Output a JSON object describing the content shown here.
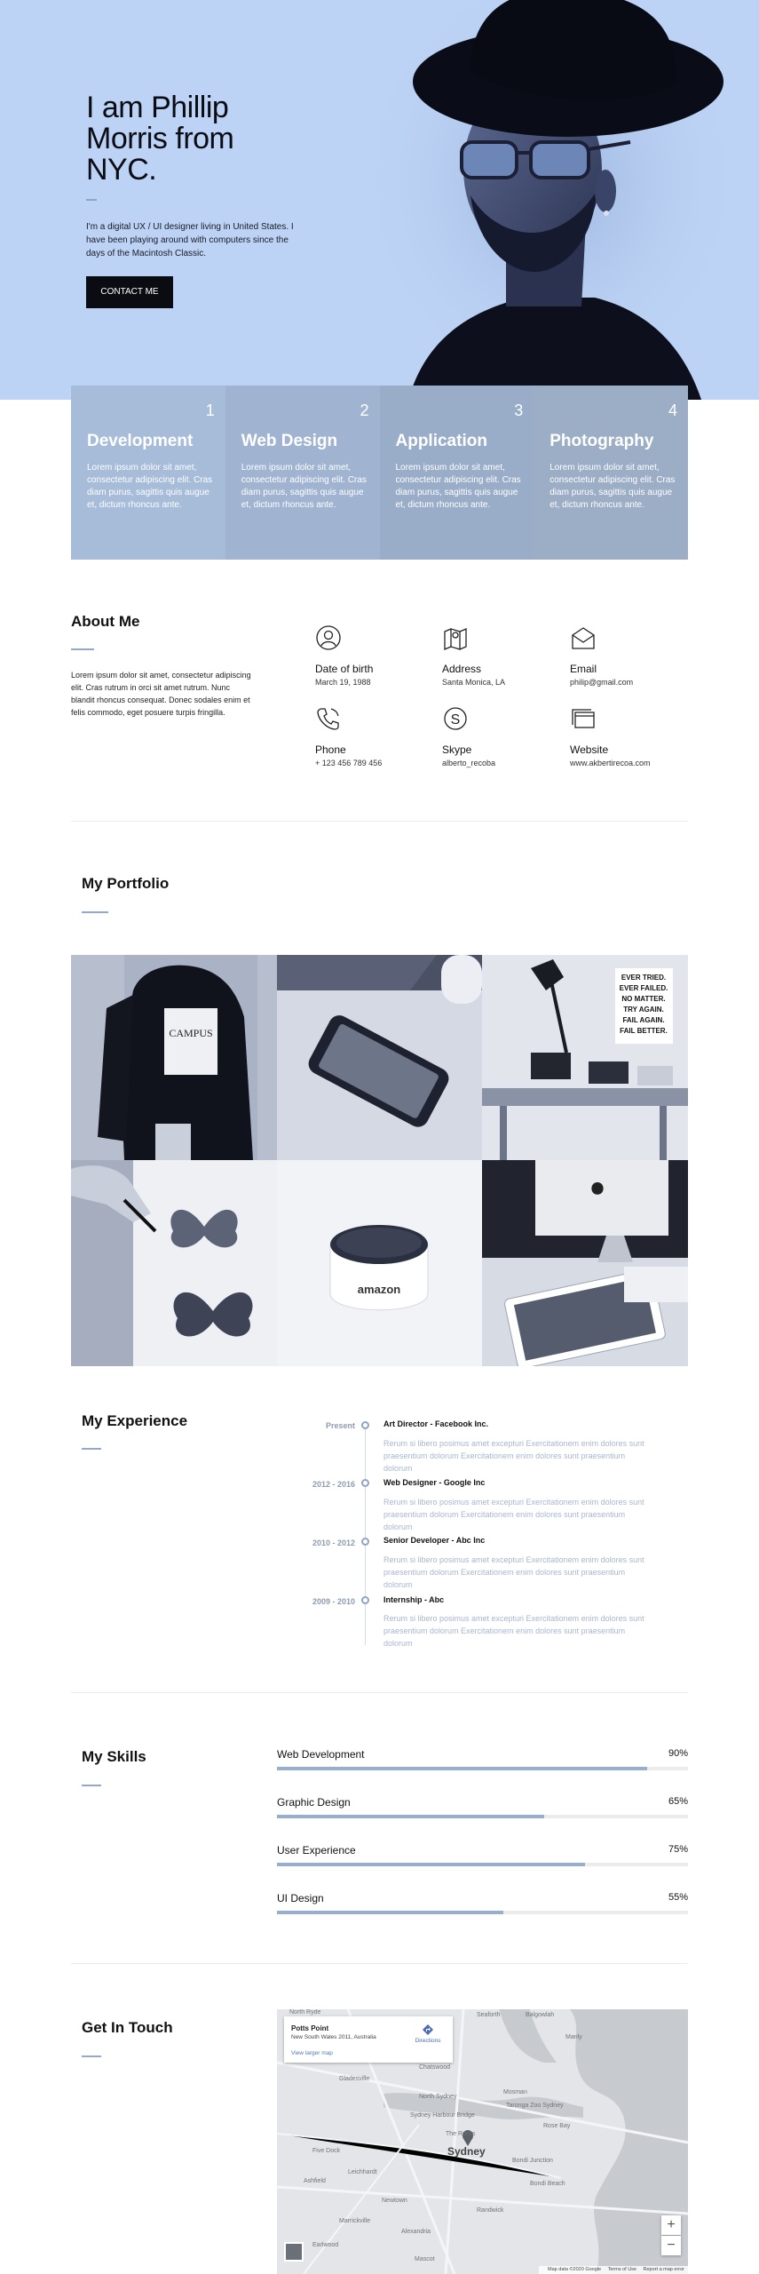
{
  "hero": {
    "title": "I am Phillip Morris from NYC.",
    "intro": "I'm a digital UX / UI designer living in United States. I have been playing around with computers since the days of the Macintosh Classic.",
    "button_label": "CONTACT ME"
  },
  "services": [
    {
      "number": "1",
      "title": "Development",
      "text": "Lorem ipsum dolor sit amet, consectetur adipiscing elit. Cras diam purus, sagittis quis augue et, dictum rhoncus ante."
    },
    {
      "number": "2",
      "title": "Web Design",
      "text": "Lorem ipsum dolor sit amet, consectetur adipiscing elit. Cras diam purus, sagittis quis augue et, dictum rhoncus ante."
    },
    {
      "number": "3",
      "title": "Application",
      "text": "Lorem ipsum dolor sit amet, consectetur adipiscing elit. Cras diam purus, sagittis quis augue et, dictum rhoncus ante."
    },
    {
      "number": "4",
      "title": "Photography",
      "text": "Lorem ipsum dolor sit amet, consectetur adipiscing elit. Cras diam purus, sagittis quis augue et, dictum rhoncus ante."
    }
  ],
  "about": {
    "title": "About Me",
    "text": "Lorem ipsum dolor sit amet, consectetur adipiscing elit. Cras rutrum in orci sit amet rutrum. Nunc blandit rhoncus consequat. Donec sodales enim et felis commodo, eget posuere turpis fringilla.",
    "items": [
      {
        "icon": "user-icon",
        "label": "Date of birth",
        "value": "March 19, 1988"
      },
      {
        "icon": "map-icon",
        "label": "Address",
        "value": "Santa Monica, LA"
      },
      {
        "icon": "envelope-icon",
        "label": "Email",
        "value": "philip@gmail.com"
      },
      {
        "icon": "phone-icon",
        "label": "Phone",
        "value": "+ 123 456 789 456"
      },
      {
        "icon": "skype-icon",
        "label": "Skype",
        "value": "alberto_recoba"
      },
      {
        "icon": "browser-icon",
        "label": "Website",
        "value": "www.akbertirecoa.com"
      }
    ]
  },
  "portfolio": {
    "title": "My Portfolio",
    "items": [
      {
        "icon": "fashion-sweatshirt-photo"
      },
      {
        "icon": "smartphone-photo"
      },
      {
        "icon": "desk-lamp-photo",
        "poster_text": "EVER TRIED. EVER FAILED. NO MATTER. TRY AGAIN. FAIL AGAIN. FAIL BETTER."
      },
      {
        "icon": "butterfly-sketch-photo"
      },
      {
        "icon": "amazon-echo-photo",
        "brand_text": "amazon"
      },
      {
        "icon": "imac-tablet-photo"
      }
    ]
  },
  "experience": {
    "title": "My Experience",
    "items": [
      {
        "date": "Present",
        "role": "Art Director - Facebook Inc.",
        "desc": "Rerum si libero posimus amet excepturi Exercitationem enim dolores sunt praesentium dolorum Exercitationem enim dolores sunt praesentium dolorum"
      },
      {
        "date": "2012 - 2016",
        "role": "Web Designer - Google Inc",
        "desc": "Rerum si libero posimus amet excepturi Exercitationem enim dolores sunt praesentium dolorum Exercitationem enim dolores sunt praesentium dolorum"
      },
      {
        "date": "2010 - 2012",
        "role": "Senior Developer - Abc Inc",
        "desc": "Rerum si libero posimus amet excepturi Exercitationem enim dolores sunt praesentium dolorum Exercitationem enim dolores sunt praesentium dolorum"
      },
      {
        "date": "2009 - 2010",
        "role": "Internship - Abc",
        "desc": "Rerum si libero posimus amet excepturi Exercitationem enim dolores sunt praesentium dolorum Exercitationem enim dolores sunt praesentium dolorum"
      }
    ]
  },
  "skills": {
    "title": "My Skills",
    "items": [
      {
        "name": "Web Development",
        "label": "90%",
        "level": 0.9
      },
      {
        "name": "Graphic Design",
        "label": "65%",
        "level": 0.65
      },
      {
        "name": "User Experience",
        "label": "75%",
        "level": 0.75
      },
      {
        "name": "UI Design",
        "label": "55%",
        "level": 0.55
      }
    ]
  },
  "contact": {
    "title": "Get In Touch",
    "map": {
      "place": "Potts Point",
      "address": "New South Wales 2011, Australia",
      "larger_map": "View larger map",
      "directions": "Directions",
      "labels": [
        "North Ryde",
        "Seaforth",
        "Balgowlah",
        "Manly",
        "Chatswood",
        "Gladesville",
        "North Sydney",
        "Mosman",
        "Taronga Zoo Sydney",
        "Sydney Harbour Bridge",
        "Five Dock",
        "Sydney",
        "The Rocks",
        "Bondi Junction",
        "Ashfield",
        "Leichhardt",
        "Newtown",
        "Randwick",
        "Marrickville",
        "Bondi Beach",
        "Earlwood",
        "Alexandria",
        "Mascot",
        "Rose Bay"
      ],
      "zoom_in": "+",
      "zoom_out": "−",
      "footer": [
        "Map data ©2020 Google",
        "Terms of Use",
        "Report a map error"
      ]
    }
  },
  "colors": {
    "hero_bg": "#bcd3f5",
    "accent": "#94a8cc",
    "button_bg": "#0b0b12"
  }
}
